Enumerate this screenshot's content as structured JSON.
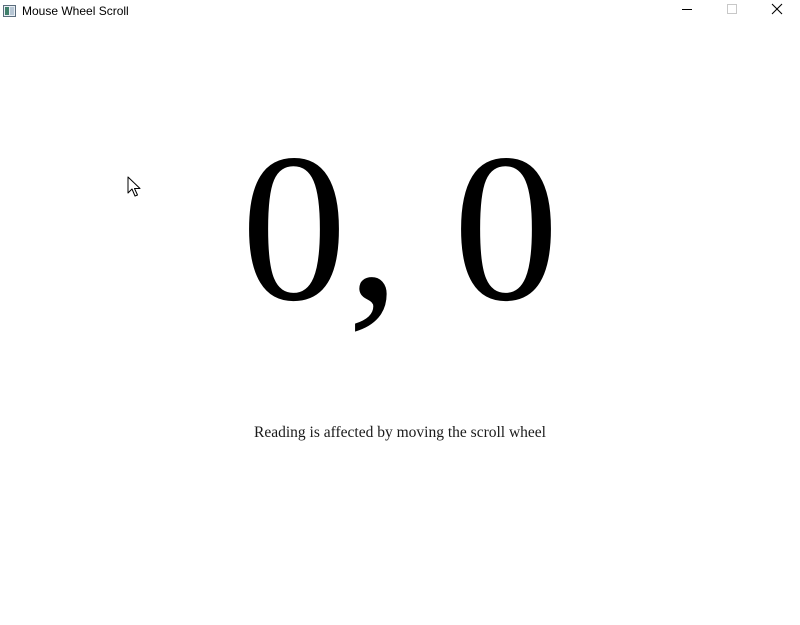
{
  "window": {
    "title": "Mouse Wheel Scroll",
    "icon": "app-window-icon",
    "controls": {
      "minimize_icon": "minimize-icon",
      "maximize_icon": "maximize-icon",
      "close_icon": "close-icon"
    }
  },
  "main": {
    "reading": "0, 0",
    "caption": "Reading is affected by moving the scroll wheel"
  },
  "cursor": {
    "icon": "mouse-pointer-icon"
  }
}
